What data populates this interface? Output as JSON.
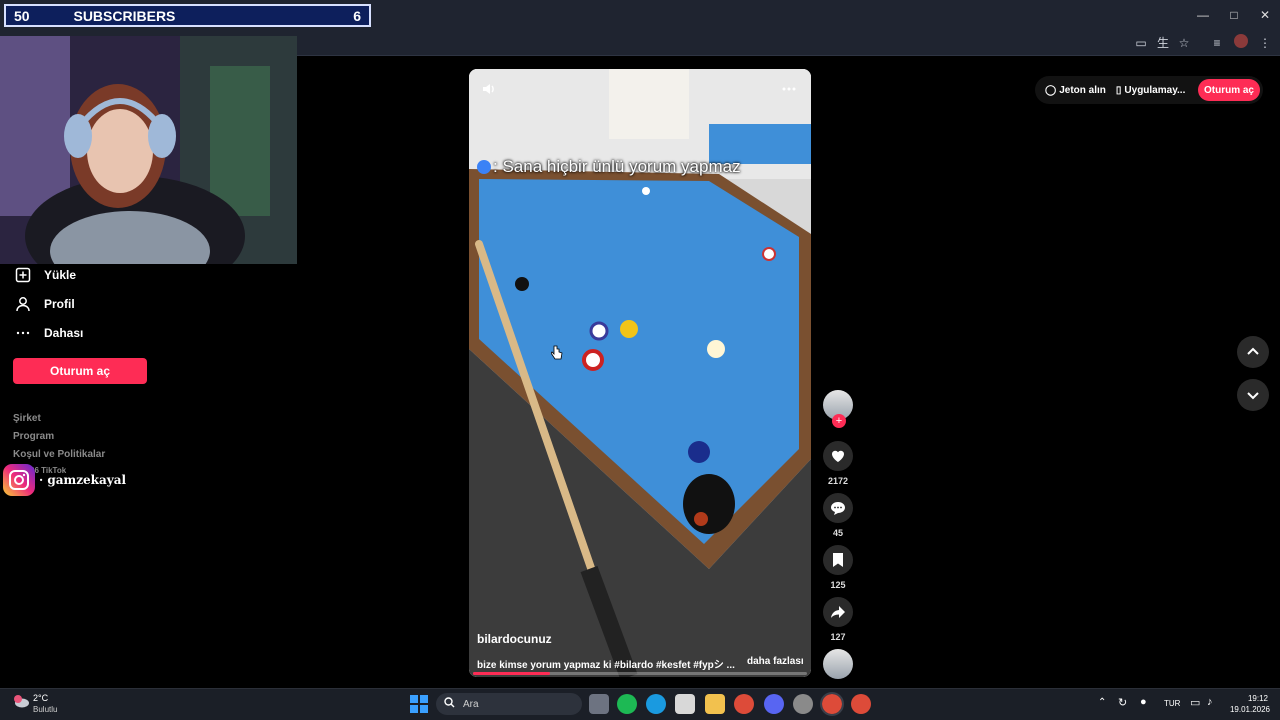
{
  "overlay": {
    "subscribers_left": "50",
    "subscribers_title": "SUBSCRIBERS",
    "subscribers_right": "6",
    "instagram_handle": "· gamzekayal"
  },
  "sidebar": {
    "items": [
      {
        "label": "Yükle",
        "icon": "upload-icon"
      },
      {
        "label": "Profil",
        "icon": "person-icon"
      },
      {
        "label": "Dahası",
        "icon": "more-icon"
      }
    ],
    "login_label": "Oturum aç",
    "footer_links": [
      "Şirket",
      "Program",
      "Koşul ve Politikalar"
    ],
    "copyright": "© 2026 TikTok"
  },
  "header_right": {
    "coins_label": "Jeton alın",
    "app_label": "Uygulamay...",
    "login_label": "Oturum aç"
  },
  "video": {
    "caption": ": Sana hiçbir ünlü yorum yapmaz",
    "author": "bilardocunuz",
    "description": "bize kimse yorum yapmaz ki #bilardo #kesfet #fypシ ...",
    "more_label": "daha fazlası",
    "progress": 0.23
  },
  "actions": {
    "likes": "2172",
    "comments": "45",
    "saves": "125",
    "shares": "127"
  },
  "taskbar": {
    "weather_temp": "2°C",
    "weather_desc": "Bulutlu",
    "search_placeholder": "Ara",
    "language": "TUR",
    "time": "19:12",
    "date": "19.01.2026"
  },
  "colors": {
    "accent": "#fe2c55",
    "table_felt": "#3f8fd8",
    "background": "#000000"
  }
}
